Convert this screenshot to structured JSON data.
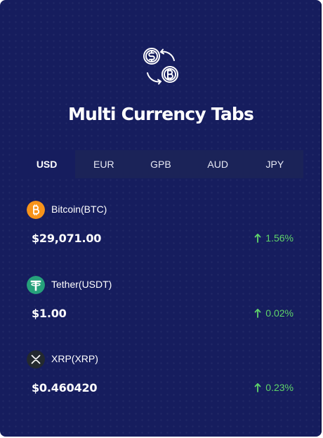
{
  "widget": {
    "title": "Multi Currency Tabs",
    "logo_icon": "currency-exchange-icon",
    "accent_color": "#5fd46a",
    "background_color": "#161d5e"
  },
  "tabs": [
    {
      "label": "USD",
      "active": true
    },
    {
      "label": "EUR",
      "active": false
    },
    {
      "label": "GPB",
      "active": false
    },
    {
      "label": "AUD",
      "active": false
    },
    {
      "label": "JPY",
      "active": false
    }
  ],
  "coins": [
    {
      "name": "Bitcoin(BTC)",
      "price": "$29,071.00",
      "change": "1.56%",
      "icon": "bitcoin-icon",
      "color": "#f7931a"
    },
    {
      "name": "Tether(USDT)",
      "price": "$1.00",
      "change": "0.02%",
      "icon": "tether-icon",
      "color": "#26a17b"
    },
    {
      "name": "XRP(XRP)",
      "price": "$0.460420",
      "change": "0.23%",
      "icon": "xrp-icon",
      "color": "#23292f"
    }
  ]
}
